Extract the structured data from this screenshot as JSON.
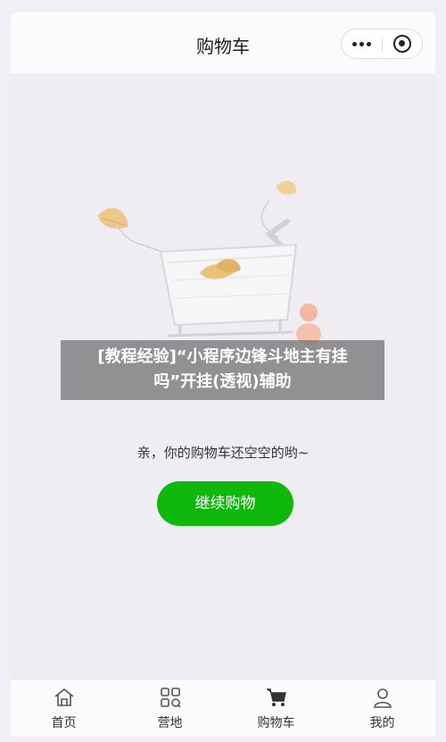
{
  "navbar": {
    "title": "购物车",
    "menu_icon": "more-dots-icon",
    "close_icon": "target-close-icon"
  },
  "overlay": {
    "line1": "[教程经验]“小程序边锋斗地主有挂",
    "line2": "吗”开挂(透视)辅助"
  },
  "empty_state": {
    "message": "亲，你的购物车还空空的哟~",
    "button_label": "继续购物",
    "illustration_icon": "empty-shopping-cart-illustration"
  },
  "colors": {
    "accent": "#10b80e",
    "background": "#efedf2"
  },
  "tabbar": {
    "items": [
      {
        "label": "首页",
        "icon": "home-icon"
      },
      {
        "label": "营地",
        "icon": "grid-icon"
      },
      {
        "label": "购物车",
        "icon": "cart-icon"
      },
      {
        "label": "我的",
        "icon": "user-icon"
      }
    ]
  }
}
